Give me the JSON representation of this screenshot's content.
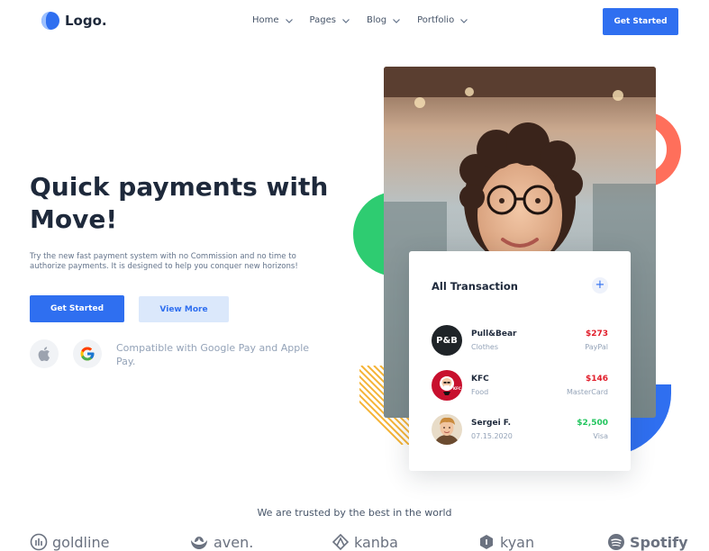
{
  "header": {
    "logo_text": "Logo.",
    "nav": [
      {
        "label": "Home"
      },
      {
        "label": "Pages"
      },
      {
        "label": "Blog"
      },
      {
        "label": "Portfolio"
      }
    ],
    "cta_label": "Get Started"
  },
  "hero": {
    "title": "Quick payments with Move!",
    "description": "Try the new fast payment system with no Commission and no time to authorize payments. It is designed to help you conquer new horizons!",
    "primary_button": "Get Started",
    "secondary_button": "View More",
    "compatible_text": "Compatible with Google Pay and Apple Pay."
  },
  "transactions": {
    "title": "All Transaction",
    "add_symbol": "+",
    "items": [
      {
        "name": "Pull&Bear",
        "category": "Clothes",
        "amount": "$273",
        "method": "PayPal",
        "avatar_text": "P&B",
        "amount_color": "#e11d2a"
      },
      {
        "name": "KFC",
        "category": "Food",
        "amount": "$146",
        "method": "MasterCard",
        "avatar_text": "KFC",
        "amount_color": "#e11d2a"
      },
      {
        "name": "Sergei F.",
        "category": "07.15.2020",
        "amount": "$2,500",
        "method": "Visa",
        "avatar_text": "",
        "amount_color": "#22c55e"
      }
    ]
  },
  "trusted": {
    "heading": "We are trusted by the best in the world",
    "brands": [
      "goldline",
      "aven.",
      "kanba",
      "kyan",
      "Spotify"
    ]
  },
  "colors": {
    "primary": "#2f6ff0",
    "secondary_bg": "#dbe8fb",
    "green_blob": "#2ecc71",
    "orange_ring": "#ff6f5b",
    "blue_blob": "#2f6ff0",
    "yellow_stripes": "#f5b335"
  },
  "icons": {
    "apple": "apple-icon",
    "google": "google-icon",
    "nav_chevron": "chevron-down-icon"
  }
}
